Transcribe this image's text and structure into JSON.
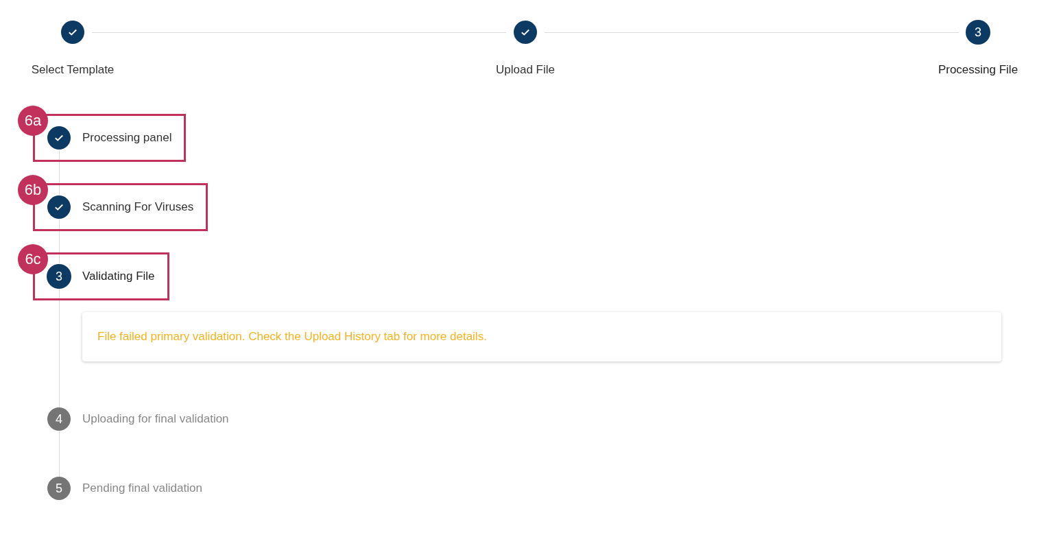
{
  "stepper": {
    "steps": [
      {
        "label": "Select Template",
        "completed": true,
        "active": false
      },
      {
        "label": "Upload File",
        "completed": true,
        "active": false
      },
      {
        "label": "Processing File",
        "completed": false,
        "active": true,
        "number": "3"
      }
    ]
  },
  "processing": {
    "steps": [
      {
        "label": "Processing panel",
        "completed": true,
        "active": false,
        "annotation": "6a"
      },
      {
        "label": "Scanning For Viruses",
        "completed": true,
        "active": false,
        "annotation": "6b"
      },
      {
        "label": "Validating File",
        "completed": false,
        "active": true,
        "number": "3",
        "annotation": "6c",
        "message": "File failed primary validation. Check the Upload History tab for more details."
      },
      {
        "label": "Uploading for final validation",
        "completed": false,
        "active": false,
        "number": "4"
      },
      {
        "label": "Pending final validation",
        "completed": false,
        "active": false,
        "number": "5"
      }
    ]
  }
}
